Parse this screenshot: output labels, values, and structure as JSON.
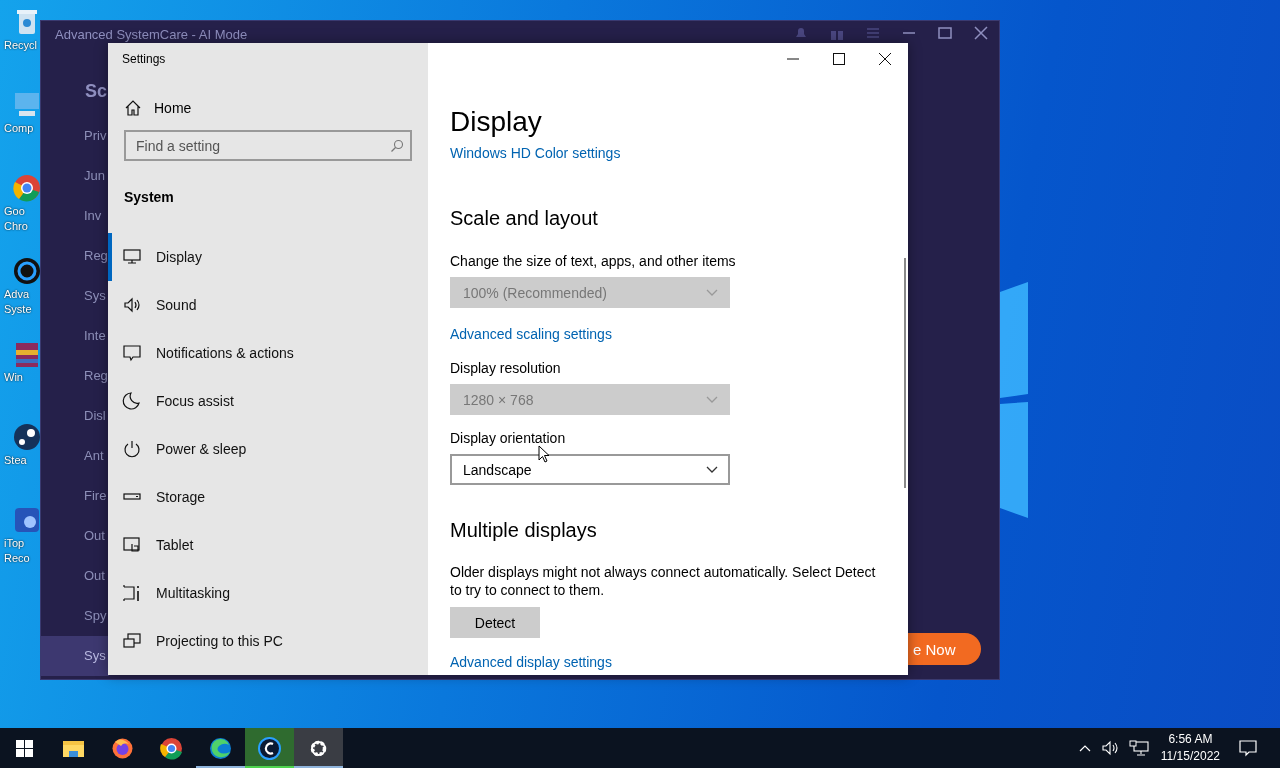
{
  "desktop_icons": [
    {
      "lines": [
        "Recycl"
      ]
    },
    {
      "lines": [
        "Comp"
      ]
    },
    {
      "lines": [
        "Goo",
        "Chro"
      ]
    },
    {
      "lines": [
        "Adva",
        "Syste"
      ]
    },
    {
      "lines": [
        "Win"
      ]
    },
    {
      "lines": [
        "Stea"
      ]
    },
    {
      "lines": [
        "iTop",
        "Reco"
      ]
    }
  ],
  "background_window": {
    "title": "Advanced SystemCare - AI Mode",
    "heading": "Sc",
    "nav": [
      {
        "label": "Priv",
        "selected": false
      },
      {
        "label": "Jun",
        "selected": false
      },
      {
        "label": "Inv",
        "selected": false
      },
      {
        "label": "Reg",
        "selected": false
      },
      {
        "label": "Sys",
        "selected": false
      },
      {
        "label": "Inte",
        "selected": false
      },
      {
        "label": "Reg",
        "selected": false
      },
      {
        "label": "Disl",
        "selected": false
      },
      {
        "label": "Ant",
        "selected": false
      },
      {
        "label": "Fire",
        "selected": false
      },
      {
        "label": "Out",
        "selected": false
      },
      {
        "label": "Out",
        "selected": false
      },
      {
        "label": "Spy",
        "selected": false
      },
      {
        "label": "Sys",
        "selected": true
      }
    ],
    "action_button": "e Now"
  },
  "settings": {
    "title": "Settings",
    "home": "Home",
    "search": {
      "placeholder": "Find a setting"
    },
    "section": "System",
    "nav": [
      {
        "label": "Display",
        "selected": true
      },
      {
        "label": "Sound",
        "selected": false
      },
      {
        "label": "Notifications & actions",
        "selected": false
      },
      {
        "label": "Focus assist",
        "selected": false
      },
      {
        "label": "Power & sleep",
        "selected": false
      },
      {
        "label": "Storage",
        "selected": false
      },
      {
        "label": "Tablet",
        "selected": false
      },
      {
        "label": "Multitasking",
        "selected": false
      },
      {
        "label": "Projecting to this PC",
        "selected": false
      }
    ],
    "page_title": "Display",
    "content": [
      {
        "kind": "link",
        "text": "Windows HD Color settings"
      },
      {
        "kind": "heading",
        "text": "Scale and layout"
      },
      {
        "kind": "label",
        "text": "Change the size of text, apps, and other items"
      },
      {
        "kind": "dropdown",
        "value": "100% (Recommended)",
        "disabled": true
      },
      {
        "kind": "link",
        "text": "Advanced scaling settings"
      },
      {
        "kind": "label",
        "text": "Display resolution"
      },
      {
        "kind": "dropdown",
        "value": "1280 × 768",
        "disabled": true
      },
      {
        "kind": "label",
        "text": "Display orientation"
      },
      {
        "kind": "dropdown",
        "value": "Landscape",
        "disabled": false
      },
      {
        "kind": "heading",
        "text": "Multiple displays"
      },
      {
        "kind": "paragraph",
        "text": "Older displays might not always connect automatically. Select Detect to try to connect to them."
      },
      {
        "kind": "button",
        "text": "Detect"
      },
      {
        "kind": "link",
        "text": "Advanced display settings"
      }
    ]
  },
  "taskbar": {
    "apps": [
      {
        "running": false,
        "active": false,
        "attention": false
      },
      {
        "running": false,
        "active": false,
        "attention": false
      },
      {
        "running": false,
        "active": false,
        "attention": false
      },
      {
        "running": true,
        "active": false,
        "attention": false
      },
      {
        "running": true,
        "active": false,
        "attention": true
      },
      {
        "running": true,
        "active": true,
        "attention": false
      }
    ],
    "time": "6:56 AM",
    "date": "11/15/2022"
  }
}
